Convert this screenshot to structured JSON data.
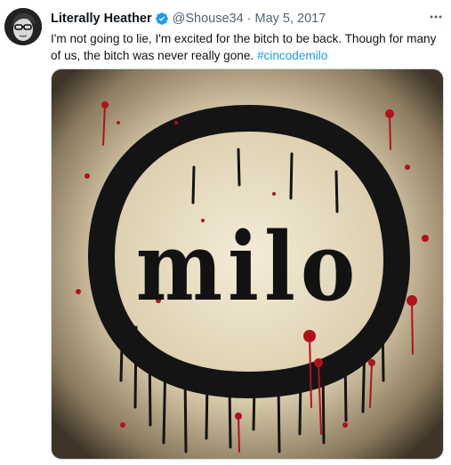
{
  "tweet": {
    "display_name": "Literally Heather",
    "handle": "@Shouse34",
    "separator": "·",
    "date": "May 5, 2017",
    "text_before": "I'm not going to lie, I'm excited for the bitch to be back. Though for many of us, the bitch was never really gone. ",
    "hashtag": "#cincodemilo",
    "verified": true,
    "icons": {
      "verified": "verified-badge-icon",
      "more": "more-options-icon"
    }
  },
  "media": {
    "logo_text": "milo"
  },
  "colors": {
    "accent": "#1d9bf0",
    "text": "#0f1419",
    "secondary_text": "#536471"
  }
}
